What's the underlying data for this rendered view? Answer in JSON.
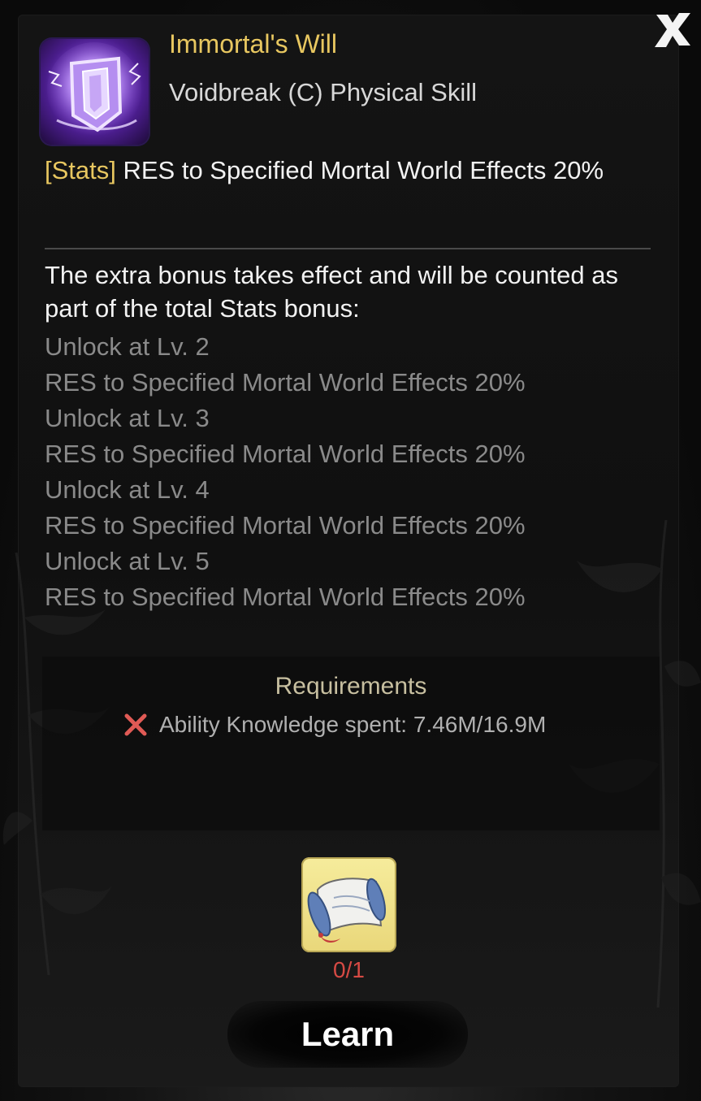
{
  "skill": {
    "name": "Immortal's Will",
    "type": "Voidbreak (C) Physical Skill",
    "icon": "shield-icon"
  },
  "stats": {
    "tag": "[Stats]",
    "text": " RES to Specified Mortal World Effects 20%"
  },
  "bonus": {
    "intro": "The extra bonus takes effect and will be counted as part of the total Stats bonus:",
    "unlocks": [
      {
        "level": "Unlock at Lv. 2",
        "effect": "RES to Specified Mortal World Effects 20%"
      },
      {
        "level": "Unlock at Lv. 3",
        "effect": "RES to Specified Mortal World Effects 20%"
      },
      {
        "level": "Unlock at Lv. 4",
        "effect": "RES to Specified Mortal World Effects 20%"
      },
      {
        "level": "Unlock at Lv. 5",
        "effect": "RES to Specified Mortal World Effects 20%"
      }
    ]
  },
  "requirements": {
    "title": "Requirements",
    "items": [
      {
        "status": "unmet",
        "text": "Ability Knowledge spent: 7.46M/16.9M"
      }
    ]
  },
  "cost": {
    "item_icon": "scroll-icon",
    "count": "0/1",
    "count_color": "#d64a44"
  },
  "actions": {
    "learn_label": "Learn",
    "close_icon": "close-icon"
  },
  "colors": {
    "accent_gold": "#e8c760",
    "unmet_red": "#e05a55",
    "muted_text": "#8a8a8a"
  }
}
